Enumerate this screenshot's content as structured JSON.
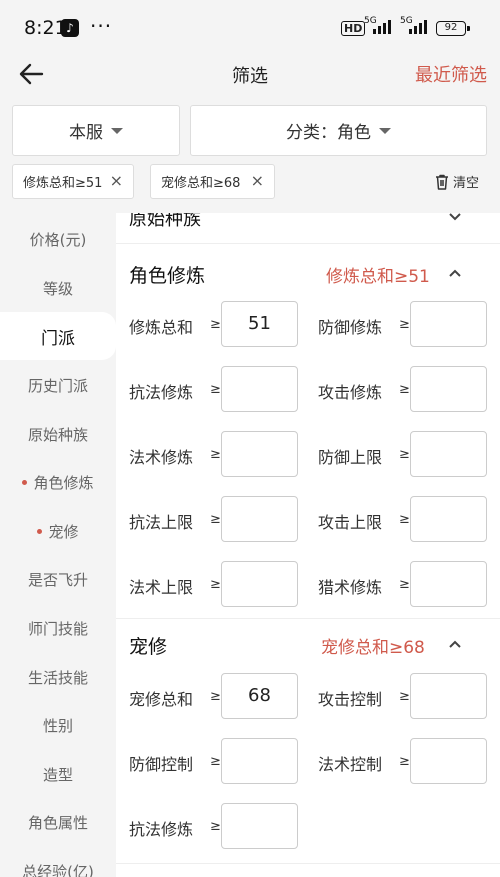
{
  "status_bar": {
    "time": "8:21",
    "more": "···",
    "hd": "HD",
    "net1": "5G",
    "net2": "5G",
    "battery": "92"
  },
  "nav": {
    "title": "筛选",
    "recent": "最近筛选"
  },
  "filters": {
    "server": "本服",
    "category": "分类：角色"
  },
  "chips": [
    {
      "label": "修炼总和≥51"
    },
    {
      "label": "宠修总和≥68"
    }
  ],
  "clear_label": "清空",
  "sidebar": [
    {
      "label": "价格(元)"
    },
    {
      "label": "等级"
    },
    {
      "label": "门派"
    },
    {
      "label": "历史门派"
    },
    {
      "label": "原始种族"
    },
    {
      "label": "角色修炼"
    },
    {
      "label": "宠修"
    },
    {
      "label": "是否飞升"
    },
    {
      "label": "师门技能"
    },
    {
      "label": "生活技能"
    },
    {
      "label": "性别"
    },
    {
      "label": "造型"
    },
    {
      "label": "角色属性"
    },
    {
      "label": "总经验(亿)"
    }
  ],
  "main": {
    "prev_section": "原始种族",
    "ge": "≥",
    "role_cultivation": {
      "title": "角色修炼",
      "summary": "修炼总和≥51",
      "fields": [
        {
          "label": "修炼总和",
          "value": "51"
        },
        {
          "label": "防御修炼",
          "value": ""
        },
        {
          "label": "抗法修炼",
          "value": ""
        },
        {
          "label": "攻击修炼",
          "value": ""
        },
        {
          "label": "法术修炼",
          "value": ""
        },
        {
          "label": "防御上限",
          "value": ""
        },
        {
          "label": "抗法上限",
          "value": ""
        },
        {
          "label": "攻击上限",
          "value": ""
        },
        {
          "label": "法术上限",
          "value": ""
        },
        {
          "label": "猎术修炼",
          "value": ""
        }
      ]
    },
    "pet_cultivation": {
      "title": "宠修",
      "summary": "宠修总和≥68",
      "fields": [
        {
          "label": "宠修总和",
          "value": "68"
        },
        {
          "label": "攻击控制",
          "value": ""
        },
        {
          "label": "防御控制",
          "value": ""
        },
        {
          "label": "法术控制",
          "value": ""
        },
        {
          "label": "抗法修炼",
          "value": ""
        }
      ]
    }
  }
}
